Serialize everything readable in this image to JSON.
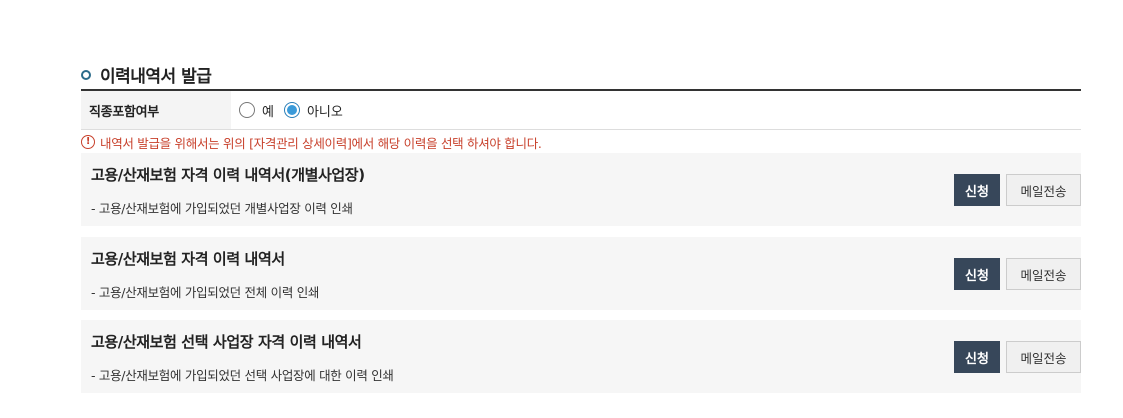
{
  "section": {
    "title": "이력내역서 발급"
  },
  "form": {
    "label": "직종포함여부",
    "options": [
      {
        "label": "예",
        "checked": false
      },
      {
        "label": "아니오",
        "checked": true
      }
    ]
  },
  "notice": {
    "icon": "exclamation-circle-icon",
    "text": "내역서 발급을 위해서는 위의 [자격관리 상세이력]에서 해당 이력을 선택 하셔야 합니다."
  },
  "cards": [
    {
      "title": "고용/산재보험 자격 이력 내역서(개별사업장)",
      "desc": "- 고용/산재보험에 가입되었던 개별사업장 이력 인쇄",
      "apply_label": "신청",
      "mail_label": "메일전송"
    },
    {
      "title": "고용/산재보험 자격 이력 내역서",
      "desc": "- 고용/산재보험에 가입되었던 전체 이력 인쇄",
      "apply_label": "신청",
      "mail_label": "메일전송"
    },
    {
      "title": "고용/산재보험 선택 사업장 자격 이력 내역서",
      "desc": "- 고용/산재보험에 가입되었던 선택 사업장에 대한 이력 인쇄",
      "apply_label": "신청",
      "mail_label": "메일전송"
    }
  ],
  "colors": {
    "accent": "#2b6b8a",
    "apply_button": "#37475a",
    "notice": "#c8412c",
    "radio_checked": "#3a9ad9"
  }
}
